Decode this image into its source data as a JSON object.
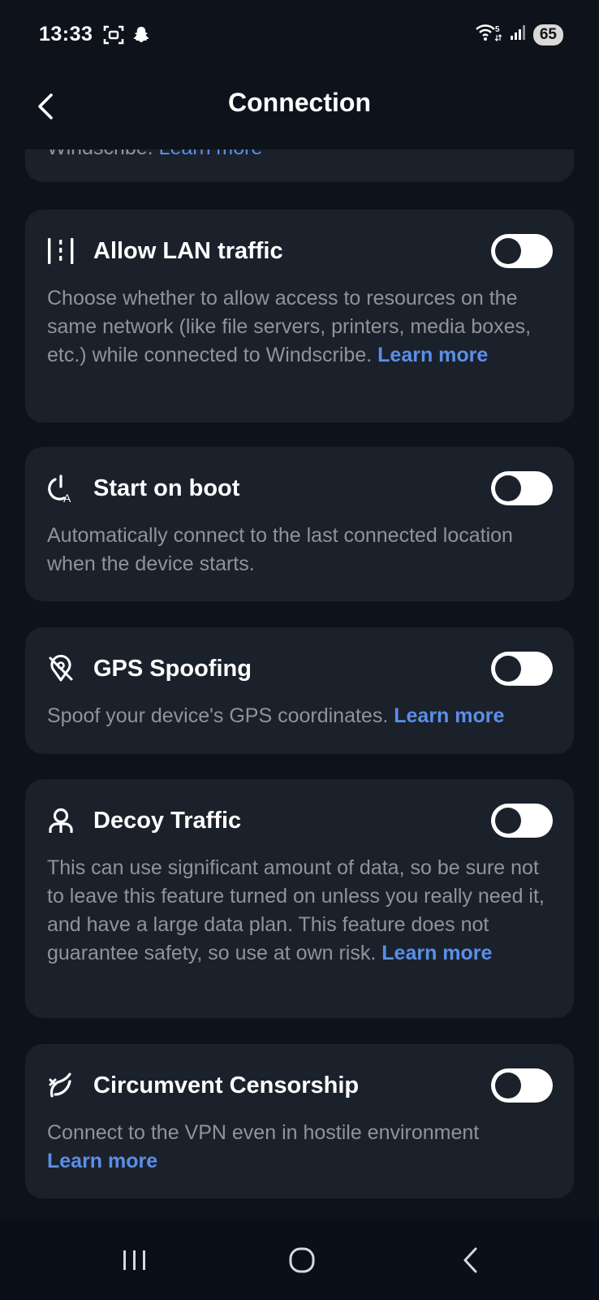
{
  "status_bar": {
    "time": "13:33",
    "battery": "65"
  },
  "header": {
    "title": "Connection"
  },
  "partial_card": {
    "text": "Windscribe.",
    "link": "Learn more"
  },
  "settings": [
    {
      "icon": "lan-icon",
      "title": "Allow LAN traffic",
      "description": "Choose whether to allow access to resources on the same network (like file servers, printers, media boxes, etc.) while connected to Windscribe.",
      "link": "Learn more",
      "enabled": false
    },
    {
      "icon": "power-auto-icon",
      "title": "Start on boot",
      "description": "Automatically connect to the last connected location when the device starts.",
      "link": "",
      "enabled": false
    },
    {
      "icon": "location-off-icon",
      "title": "GPS Spoofing",
      "description": "Spoof your device's GPS coordinates.",
      "link": "Learn more",
      "enabled": false
    },
    {
      "icon": "person-icon",
      "title": "Decoy Traffic",
      "description": "This can use significant amount of data, so be sure not to leave this feature turned on unless you really need it, and have a large data plan. This feature does not guarantee safety, so use at own risk.",
      "link": "Learn more",
      "enabled": false
    },
    {
      "icon": "censorship-icon",
      "title": "Circumvent Censorship",
      "description": "Connect to the VPN even in hostile environment",
      "link": "Learn more",
      "enabled": false
    }
  ],
  "colors": {
    "background": "#0e131b",
    "card": "#1b212b",
    "link": "#5b8fe8",
    "muted_text": "#8e949c"
  }
}
